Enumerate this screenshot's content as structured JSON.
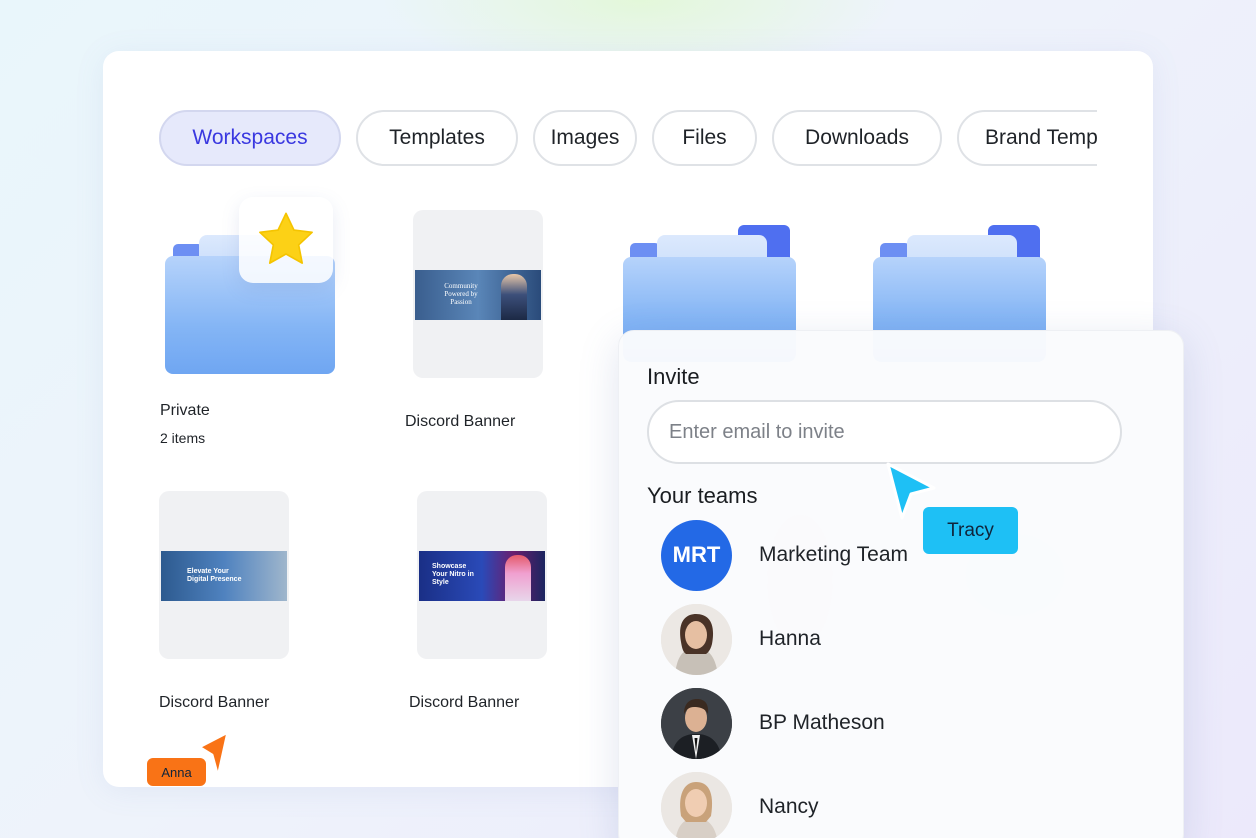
{
  "tabs": [
    {
      "label": "Workspaces",
      "active": true
    },
    {
      "label": "Templates",
      "active": false
    },
    {
      "label": "Images",
      "active": false
    },
    {
      "label": "Files",
      "active": false
    },
    {
      "label": "Downloads",
      "active": false
    },
    {
      "label": "Brand Templates",
      "active": false
    }
  ],
  "tiles": {
    "private": {
      "label": "Private",
      "count": "2 items",
      "badge_icon": "star-icon"
    },
    "banner_1": {
      "label": "Discord Banner",
      "banner_text": "Community Powered by Passion"
    },
    "banner_2": {
      "label": "Discord Banner",
      "banner_text": "Elevate Your Digital Presence"
    },
    "banner_3": {
      "label": "Discord Banner",
      "banner_text": "Showcase Your Nitro in Style"
    }
  },
  "invite": {
    "title": "Invite",
    "input_placeholder": "Enter email to invite",
    "teams_title": "Your teams",
    "members": [
      {
        "name": "Marketing Team",
        "initials": "MRT"
      },
      {
        "name": "Hanna"
      },
      {
        "name": "BP Matheson"
      },
      {
        "name": "Nancy"
      }
    ]
  },
  "cursors": {
    "tracy": {
      "label": "Tracy",
      "color": "#1ec0f5"
    },
    "anna": {
      "label": "Anna",
      "color": "#f97316"
    }
  },
  "colors": {
    "accent": "#3a38e0",
    "active_tab_bg": "#e6e9fb",
    "folder_blue": "#7fb1f4",
    "star_yellow": "#fcd116"
  }
}
